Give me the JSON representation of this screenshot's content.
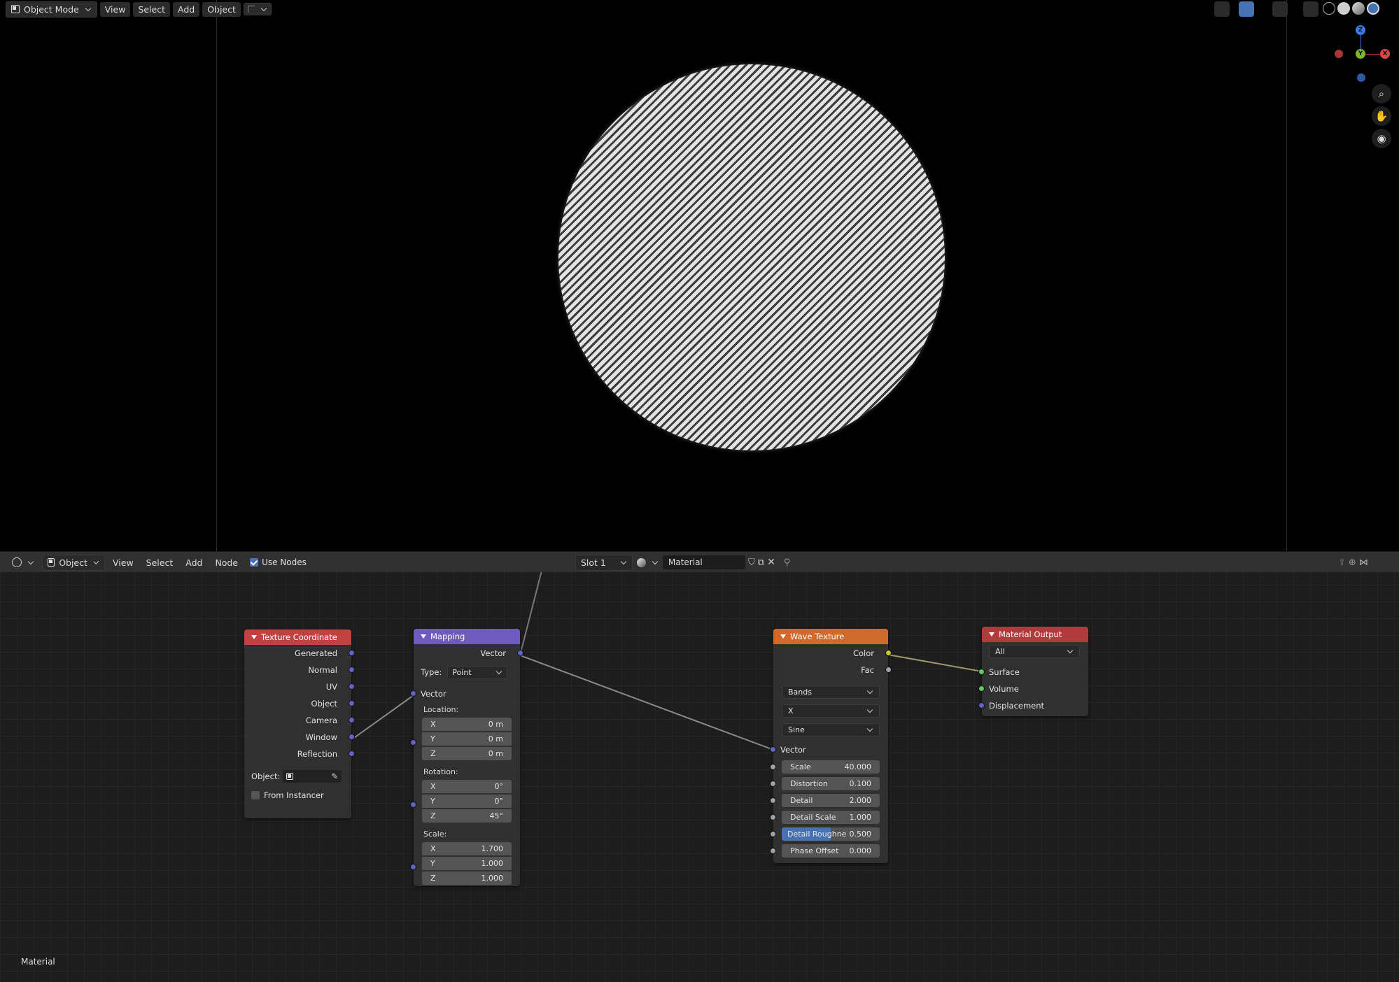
{
  "viewport": {
    "mode_label": "Object Mode",
    "menu": [
      "View",
      "Select",
      "Add",
      "Object"
    ],
    "gizmo": {
      "z": "Z",
      "y": "Y",
      "x": "X"
    }
  },
  "node_editor": {
    "editor_type_label": "Object",
    "menu": [
      "View",
      "Select",
      "Add",
      "Node"
    ],
    "use_nodes_label": "Use Nodes",
    "slot_label": "Slot 1",
    "material_name": "Material",
    "footer_label": "Material"
  },
  "nodes": {
    "texture_coordinate": {
      "title": "Texture Coordinate",
      "outputs": [
        "Generated",
        "Normal",
        "UV",
        "Object",
        "Camera",
        "Window",
        "Reflection"
      ],
      "object_label": "Object:",
      "from_instancer_label": "From Instancer"
    },
    "mapping": {
      "title": "Mapping",
      "output": "Vector",
      "type_label": "Type:",
      "type_value": "Point",
      "vector_input": "Vector",
      "location_label": "Location:",
      "location": [
        [
          "X",
          "0 m"
        ],
        [
          "Y",
          "0 m"
        ],
        [
          "Z",
          "0 m"
        ]
      ],
      "rotation_label": "Rotation:",
      "rotation": [
        [
          "X",
          "0°"
        ],
        [
          "Y",
          "0°"
        ],
        [
          "Z",
          "45°"
        ]
      ],
      "scale_label": "Scale:",
      "scale": [
        [
          "X",
          "1.700"
        ],
        [
          "Y",
          "1.000"
        ],
        [
          "Z",
          "1.000"
        ]
      ]
    },
    "wave_texture": {
      "title": "Wave Texture",
      "outputs": [
        "Color",
        "Fac"
      ],
      "wave_type": "Bands",
      "direction": "X",
      "profile": "Sine",
      "vector_input": "Vector",
      "params": [
        [
          "Scale",
          "40.000"
        ],
        [
          "Distortion",
          "0.100"
        ],
        [
          "Detail",
          "2.000"
        ],
        [
          "Detail Scale",
          "1.000"
        ],
        [
          "Detail Roughne",
          "0.500"
        ],
        [
          "Phase Offset",
          "0.000"
        ]
      ]
    },
    "material_output": {
      "title": "Material Output",
      "target": "All",
      "inputs": [
        "Surface",
        "Volume",
        "Displacement"
      ]
    }
  },
  "colors": {
    "texture_header": "#c24141",
    "vector_header": "#6e5bc0",
    "wave_header": "#cf6a2c",
    "output_header": "#b23a3a",
    "vector_socket": "#6363c7",
    "color_socket": "#c7c729",
    "shader_socket": "#63c763"
  }
}
